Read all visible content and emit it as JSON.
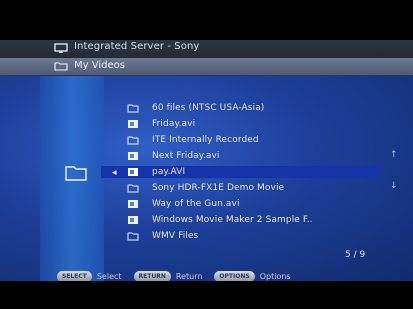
{
  "header": {
    "server_label": "Integrated Server - Sony",
    "server_icon": "monitor-icon",
    "path_label": "My Videos",
    "path_icon": "folder-icon"
  },
  "side": {
    "folder_icon": "folder-icon"
  },
  "items": [
    {
      "label": "60 files (NTSC USA-Asia)",
      "icon": "folder-icon"
    },
    {
      "label": "Friday.avi",
      "icon": "video-file-icon"
    },
    {
      "label": "ITE Internally Recorded",
      "icon": "folder-icon"
    },
    {
      "label": "Next Friday.avi",
      "icon": "video-file-icon"
    },
    {
      "label": "pay.AVI",
      "icon": "video-file-icon",
      "selected": true
    },
    {
      "label": "Sony HDR-FX1E Demo Movie",
      "icon": "folder-icon"
    },
    {
      "label": "Way of the Gun.avi",
      "icon": "video-file-icon"
    },
    {
      "label": "Windows Movie Maker 2 Sample F..",
      "icon": "video-file-icon"
    },
    {
      "label": "WMV Files",
      "icon": "folder-icon"
    }
  ],
  "selection": {
    "marker": "◂"
  },
  "scroll": {
    "up": "↑",
    "down": "↓"
  },
  "page_counter": "5 / 9",
  "footer": {
    "select_key": "SELECT",
    "select_label": "Select",
    "return_key": "RETURN",
    "return_label": "Return",
    "options_key": "OPTIONS",
    "options_label": "Options"
  },
  "colors": {
    "background": "#000000",
    "panel_blue": "#1d3f9a",
    "selection_blue": "#1534aa",
    "text_light": "#e8eefb"
  }
}
